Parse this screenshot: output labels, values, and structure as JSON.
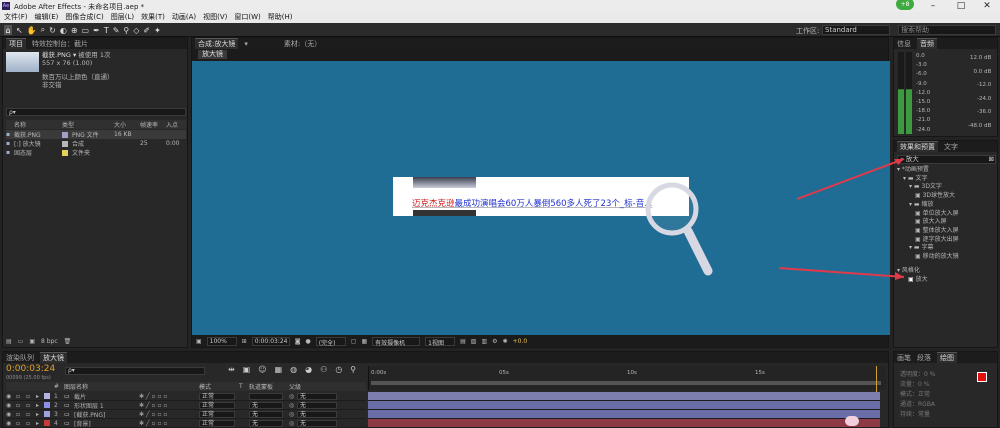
{
  "titlebar": {
    "title": "Adobe After Effects - 未命名项目.aep *",
    "min": "–",
    "max": "□",
    "close": "✕",
    "badge": "+8"
  },
  "menu": [
    "文件(F)",
    "编辑(E)",
    "图像合成(C)",
    "图层(L)",
    "效果(T)",
    "动画(A)",
    "视图(V)",
    "窗口(W)",
    "帮助(H)"
  ],
  "toolbar": {
    "workspace_label": "工作区:",
    "workspace_value": "Standard",
    "search_placeholder": "搜索帮助"
  },
  "project": {
    "tab_project": "项目",
    "tab_effects": "特效控制台：截片",
    "thumb_name": "截获.PNG ▾",
    "used": "被使用 1次",
    "dims": "557 x 76 (1.00)",
    "desc1": "数百万以上颜色（直通）",
    "desc2": "非交错",
    "search": "ρ▾",
    "headers": [
      "名称",
      "类型",
      "大小",
      "帧速率",
      "入点"
    ],
    "items": [
      {
        "name": "截获.PNG",
        "type": "PNG 文件",
        "size": "16 KB",
        "fps": "",
        "in": "",
        "color": "#a0a0c8"
      },
      {
        "name": "[:] 放大镜",
        "type": "合成",
        "size": "",
        "fps": "25",
        "in": "0:00",
        "color": "#b6b6b6"
      },
      {
        "name": "固态层",
        "type": "文件夹",
        "size": "",
        "fps": "",
        "in": "",
        "color": "#e6d25a"
      }
    ],
    "bpc": "8 bpc"
  },
  "comp": {
    "tab": "合成:放大镜",
    "lock": "▾",
    "layer_label": "素材:（无）",
    "crumb": "放大镜",
    "headline_red": "迈克杰克逊",
    "headline_blue": "最成功演唱会60万人暴倒560多人死了23个_标-音...",
    "zoom": "100%",
    "timecode": "0:00:03:24",
    "resolution": "(完全)",
    "camera": "有效摄像机",
    "views": "1视图",
    "exposure": "+0.0"
  },
  "audio": {
    "tab1": "信息",
    "tab2": "音频",
    "left": [
      "0.0",
      "-3.0",
      "-6.0",
      "-9.0",
      "-12.0",
      "-15.0",
      "-18.0",
      "-21.0",
      "-24.0"
    ],
    "right": [
      "12.0 dB",
      "0.0 dB",
      "-12.0",
      "-24.0",
      "-36.0",
      "-48.0 dB"
    ]
  },
  "effects": {
    "tab1": "效果和预置",
    "tab2": "文字",
    "search": "放大",
    "tree": [
      {
        "t": "▾ *动画预置",
        "i": 0
      },
      {
        "t": "▾ ▬ 文字",
        "i": 1
      },
      {
        "t": "▾ ▬ 3D文字",
        "i": 2
      },
      {
        "t": "▣ 3D球性放大",
        "i": 3
      },
      {
        "t": "▾ ▬ 缩放",
        "i": 2
      },
      {
        "t": "▣ 单位放大入屏",
        "i": 3
      },
      {
        "t": "▣ 放大入屏",
        "i": 3
      },
      {
        "t": "▣ 整体放大入屏",
        "i": 3
      },
      {
        "t": "▣ 逐字放大出屏",
        "i": 3
      },
      {
        "t": "▾ ▬ 字幕",
        "i": 2
      },
      {
        "t": "▣ 移动的放大镜",
        "i": 3
      }
    ],
    "stylize": "▾ 风格化",
    "magnify": "放大"
  },
  "timeline": {
    "tab_render": "渲染队列",
    "tab_comp": "放大镜",
    "timecode": "0:00:03:24",
    "frames": "00099 (25.00 fps)",
    "search": "ρ▾",
    "headers": [
      "#",
      "图层名称",
      "模式",
      "T",
      "轨道蒙板",
      "父级"
    ],
    "layers": [
      {
        "n": "1",
        "name": "截片",
        "mode": "正常",
        "track": "",
        "parent": "无",
        "color": "#b3b3e0"
      },
      {
        "n": "2",
        "name": "形状图层 1",
        "mode": "正常",
        "track": "无",
        "parent": "无",
        "color": "#8e8ee6"
      },
      {
        "n": "3",
        "name": "[截获.PNG]",
        "mode": "正常",
        "track": "无",
        "parent": "无",
        "color": "#9ea3e0"
      },
      {
        "n": "4",
        "name": "[背景]",
        "mode": "正常",
        "track": "无",
        "parent": "无",
        "color": "#c83a3a"
      }
    ],
    "ruler": [
      "0:00s",
      "05s",
      "10s",
      "15s"
    ]
  },
  "paragraph": {
    "tab1": "画笔",
    "tab2": "段落",
    "tab3": "绘图",
    "rows": [
      "透明度：0 %",
      "流量：0 %",
      "模式：正常",
      "通道：RGBA",
      "持续：常量"
    ]
  },
  "colors": {
    "accent": "#2090d8",
    "canvas": "#1f6c94",
    "fg": "#e01010",
    "bg": "#ffffff"
  }
}
